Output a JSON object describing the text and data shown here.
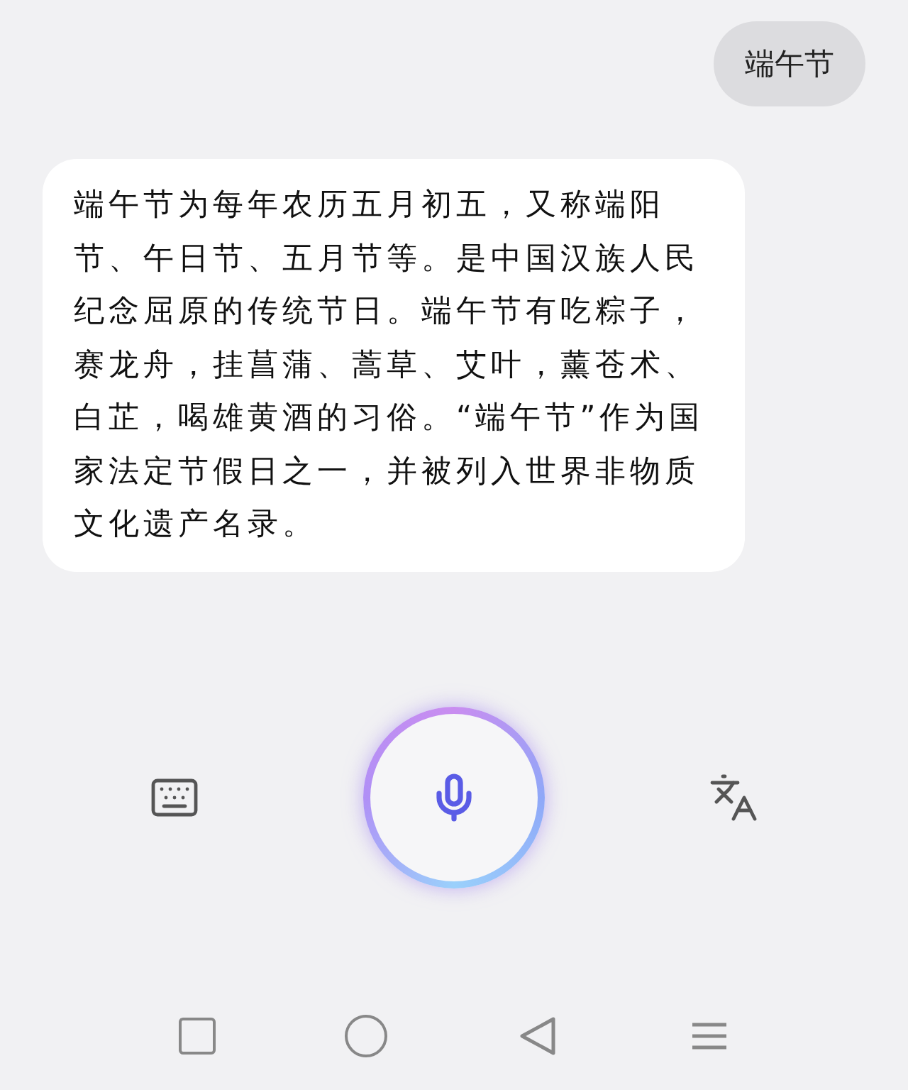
{
  "user_message": {
    "text": "端午节"
  },
  "assistant_message": {
    "text": "端午节为每年农历五月初五，又称端阳节、午日节、五月节等。是中国汉族人民纪念屈原的传统节日。端午节有吃粽子，赛龙舟，挂菖蒲、蒿草、艾叶，薰苍术、白芷，喝雄黄酒的习俗。“端午节”作为国家法定节假日之一，并被列入世界非物质文化遗产名录。"
  }
}
